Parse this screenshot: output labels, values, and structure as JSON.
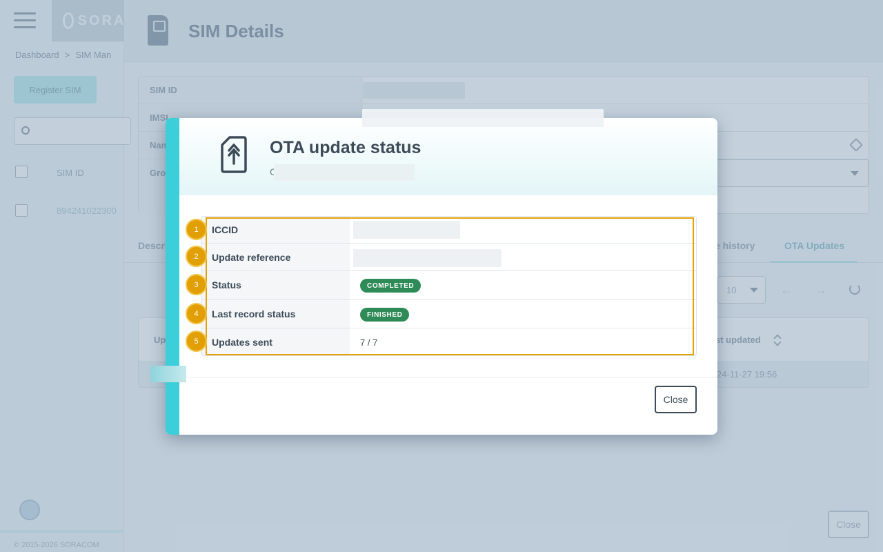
{
  "app": {
    "brand": "SORACOM",
    "breadcrumb": [
      "Dashboard",
      ">",
      "SIM Man"
    ],
    "register_button": "Register SIM",
    "table_header_sim_id": "SIM ID",
    "table_row_sim_id": "894241022300",
    "copyright": "© 2015-2026 SORACOM"
  },
  "page": {
    "title": "SIM Details",
    "detail_labels": [
      "SIM ID",
      "IMSI",
      "Name",
      "Group"
    ],
    "tabs": [
      "Descri",
      "e history",
      "OTA Updates"
    ],
    "active_tab": "OTA Updates",
    "rows_per_page": "10",
    "list_header_left": "Up",
    "list_header_right": "st updated",
    "list_row_timestamp": "24-11-27 19:56",
    "close_button": "Close"
  },
  "modal": {
    "title": "OTA update status",
    "subtitle_prefix": "C",
    "rows": [
      {
        "marker": "1",
        "label": "ICCID",
        "value": ""
      },
      {
        "marker": "2",
        "label": "Update reference",
        "value": ""
      },
      {
        "marker": "3",
        "label": "Status",
        "badge": "COMPLETED"
      },
      {
        "marker": "4",
        "label": "Last record status",
        "badge": "FINISHED"
      },
      {
        "marker": "5",
        "label": "Updates sent",
        "value": "7 / 7"
      }
    ],
    "close_button": "Close"
  },
  "colors": {
    "accent": "#3ccfd9",
    "badge_green": "#2e8b57",
    "highlight": "#e4a10a",
    "marker": "#e2a000"
  },
  "icons": {
    "modal": "ota-upload-document-icon",
    "page": "sim-card-icon"
  }
}
